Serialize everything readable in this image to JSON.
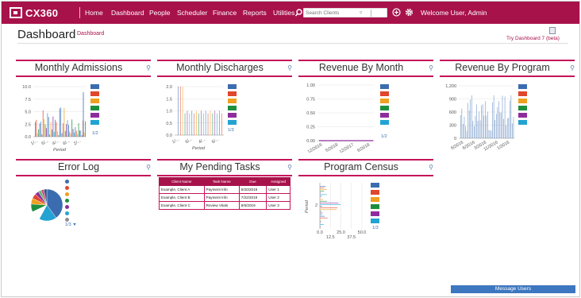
{
  "app": {
    "logo_text": "CX360",
    "welcome": "Welcome User, Admin"
  },
  "nav": {
    "items": [
      "Home",
      "Dashboard",
      "People",
      "Scheduler",
      "Finance",
      "Reports",
      "Utilities"
    ]
  },
  "search": {
    "placeholder": "Search Clients"
  },
  "icons": {
    "search": "search-icon",
    "filter": "filter-icon",
    "add": "add-circle-icon",
    "settings": "gear-icon",
    "zoom": "zoom-icon",
    "new_dashboard": "document-icon"
  },
  "header": {
    "title": "Dashboard",
    "breadcrumb": "Dashboard",
    "try_dashboard": "Try Dashboard 7 (beta)"
  },
  "colors": {
    "brand": "#a8124b",
    "accent_line": "#c4145a",
    "legend": [
      "#3b6cb0",
      "#e0472d",
      "#f0a020",
      "#1e8f3e",
      "#8e2c9e",
      "#22a3d3"
    ],
    "message_bar": "#3d77bf"
  },
  "widgets": {
    "admissions": {
      "title": "Monthly Admissions",
      "xlabel": "Period",
      "pager": "1/2"
    },
    "discharges": {
      "title": "Monthly Discharges",
      "xlabel": "Period",
      "pager": "1/3"
    },
    "revenue_month": {
      "title": "Revenue By Month",
      "pager": "1/2"
    },
    "revenue_program": {
      "title": "Revenue By Program"
    },
    "error_log": {
      "title": "Error Log",
      "pager": "1/3"
    },
    "tasks": {
      "title": "My Pending Tasks"
    },
    "census": {
      "title": "Program Census",
      "ylabel": "Period",
      "pager": "1/3"
    }
  },
  "chart_data": [
    {
      "type": "bar",
      "title": "Monthly Admissions",
      "xlabel": "Period",
      "ylim": [
        0,
        10
      ],
      "yticks": [
        "10.0",
        "7.5",
        "5.0",
        "2.5",
        "0.0"
      ],
      "xticks": [
        "1/...",
        "6/...",
        "4/...",
        "8/...",
        "2/..."
      ]
    },
    {
      "type": "bar",
      "title": "Monthly Discharges",
      "xlabel": "Period",
      "ylim": [
        0,
        2
      ],
      "yticks": [
        "2.0",
        "1.5",
        "1.0",
        "0.5",
        "0.0"
      ],
      "xticks": [
        "1/...",
        "6/...",
        "4/...",
        "6/..."
      ]
    },
    {
      "type": "line",
      "title": "Revenue By Month",
      "ylim": [
        0,
        1
      ],
      "yticks": [
        "1.00",
        "0.75",
        "0.50",
        "0.25",
        "0.00"
      ],
      "xticks": [
        "12/2016",
        "5/2018",
        "12/2017",
        "6/2018"
      ]
    },
    {
      "type": "bar",
      "title": "Revenue By Program",
      "ylim": [
        0,
        1200
      ],
      "yticks": [
        "1,200",
        "900",
        "600",
        "300",
        "0"
      ],
      "xticks": [
        "6/2016",
        "6/2016",
        "3/2016",
        "11/2016",
        "1/2016"
      ]
    },
    {
      "type": "pie",
      "title": "Error Log"
    },
    {
      "type": "bar",
      "title": "Program Census",
      "ylabel": "Period",
      "yticks": [
        "2"
      ],
      "xticks": [
        "0.0",
        "12.5",
        "25.0",
        "37.5",
        "50.0"
      ]
    }
  ],
  "tasks": {
    "columns": [
      "Client Name",
      "Task Name",
      "Due",
      "Assigned"
    ],
    "rows": [
      [
        "Example, Client A",
        "Payment Info",
        "5/20/2019",
        "User 1"
      ],
      [
        "Example, Client B",
        "Payment Info",
        "7/22/2019",
        "User 2"
      ],
      [
        "Example, Client C",
        "Review Vitals",
        "8/6/2019",
        "User 3"
      ]
    ]
  },
  "footer": {
    "message_users": "Message Users"
  }
}
